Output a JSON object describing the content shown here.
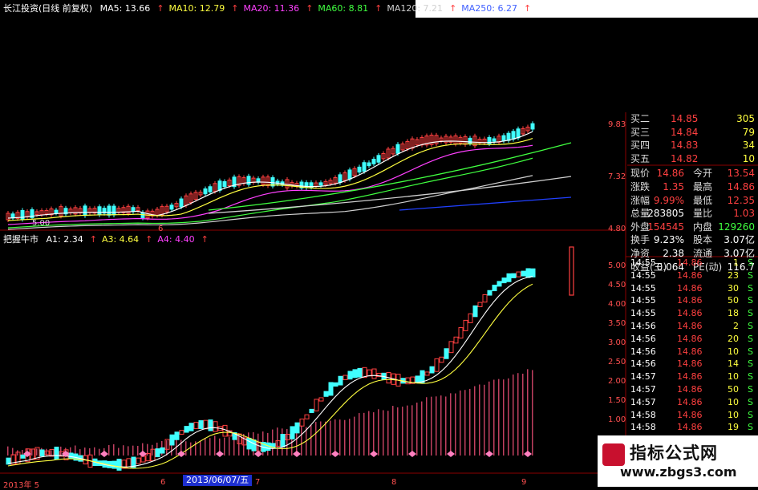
{
  "app": {
    "title": "长江投资(日线 前复权)"
  },
  "ma_legend": [
    {
      "label": "MA5: 13.66",
      "color": "#ffffff"
    },
    {
      "label": "MA10: 12.79",
      "color": "#ffff40"
    },
    {
      "label": "MA20: 11.36",
      "color": "#ff40ff"
    },
    {
      "label": "MA60: 8.81",
      "color": "#40ff40"
    },
    {
      "label": "MA120: 7.21",
      "color": "#d0d0d0"
    },
    {
      "label": "MA250: 6.27",
      "color": "#4060ff"
    }
  ],
  "sub_indicator": {
    "name": "把握牛市",
    "values": [
      {
        "label": "A1: 2.34",
        "color": "#ffffff"
      },
      {
        "label": "A3: 4.64",
        "color": "#ffff40"
      },
      {
        "label": "A4: 4.40",
        "color": "#ff40ff"
      }
    ]
  },
  "price_axis": [
    "9.83",
    "7.32",
    "4.80"
  ],
  "sub_axis": [
    "5.00",
    "4.50",
    "4.00",
    "3.50",
    "3.00",
    "2.50",
    "2.00",
    "1.50",
    "1.00"
  ],
  "x_axis": {
    "start": "2013年 5",
    "marks": [
      "6",
      "7",
      "8",
      "9"
    ],
    "cursor_date": "2013/06/07/五",
    "low_label": "5.00",
    "mid_mark": "6"
  },
  "quote_panel": {
    "bids": [
      {
        "label": "买二",
        "price": "14.85",
        "vol": "305"
      },
      {
        "label": "买三",
        "price": "14.84",
        "vol": "79"
      },
      {
        "label": "买四",
        "price": "14.83",
        "vol": "34"
      },
      {
        "label": "买五",
        "price": "14.82",
        "vol": "10"
      }
    ],
    "stats": [
      {
        "l1": "现价",
        "v1": "14.86",
        "l2": "今开",
        "v2": "13.54"
      },
      {
        "l1": "涨跌",
        "v1": "1.35",
        "l2": "最高",
        "v2": "14.86"
      },
      {
        "l1": "涨幅",
        "v1": "9.99%",
        "l2": "最低",
        "v2": "12.35"
      },
      {
        "l1": "总量",
        "v1": "283805",
        "l2": "量比",
        "v2": "1.03"
      },
      {
        "l1": "外盘",
        "v1": "154545",
        "l2": "内盘",
        "v2": "129260"
      },
      {
        "l1": "换手",
        "v1": "9.23%",
        "l2": "股本",
        "v2": "3.07亿"
      },
      {
        "l1": "净资",
        "v1": "2.38",
        "l2": "流通",
        "v2": "3.07亿"
      },
      {
        "l1": "收益(三)",
        "v1": "0.064",
        "l2": "PE(动)",
        "v2": "116.7"
      }
    ]
  },
  "ticks": [
    {
      "time": "14:55",
      "price": "14.86",
      "vol": "1",
      "side": "S"
    },
    {
      "time": "14:55",
      "price": "14.86",
      "vol": "23",
      "side": "S"
    },
    {
      "time": "14:55",
      "price": "14.86",
      "vol": "30",
      "side": "S"
    },
    {
      "time": "14:55",
      "price": "14.86",
      "vol": "50",
      "side": "S"
    },
    {
      "time": "14:55",
      "price": "14.86",
      "vol": "18",
      "side": "S"
    },
    {
      "time": "14:56",
      "price": "14.86",
      "vol": "2",
      "side": "S"
    },
    {
      "time": "14:56",
      "price": "14.86",
      "vol": "20",
      "side": "S"
    },
    {
      "time": "14:56",
      "price": "14.86",
      "vol": "10",
      "side": "S"
    },
    {
      "time": "14:56",
      "price": "14.86",
      "vol": "14",
      "side": "S"
    },
    {
      "time": "14:57",
      "price": "14.86",
      "vol": "10",
      "side": "S"
    },
    {
      "time": "14:57",
      "price": "14.86",
      "vol": "50",
      "side": "S"
    },
    {
      "time": "14:57",
      "price": "14.86",
      "vol": "10",
      "side": "S"
    },
    {
      "time": "14:58",
      "price": "14.86",
      "vol": "10",
      "side": "S"
    },
    {
      "time": "14:58",
      "price": "14.86",
      "vol": "19",
      "side": "S"
    }
  ],
  "watermark": {
    "title": "指标公式网",
    "url": "www.zbgs3.com"
  },
  "colors": {
    "up": "#ff4040",
    "down": "#40ffff",
    "label": "#ff5050",
    "value_white": "#ffffff",
    "vol_yellow": "#ffff40",
    "side_green": "#40ff40"
  }
}
